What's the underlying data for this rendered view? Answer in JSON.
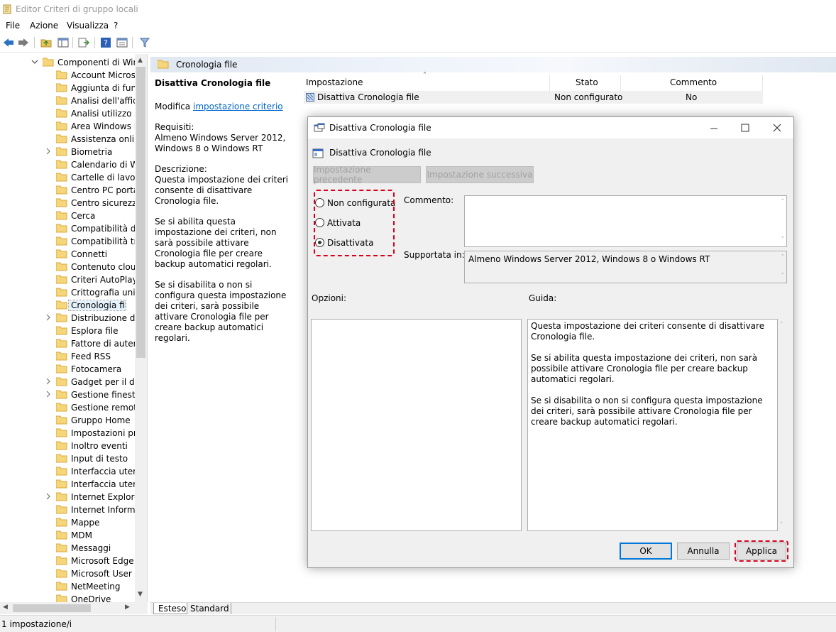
{
  "window": {
    "title": "Editor Criteri di gruppo locali"
  },
  "menu": [
    "File",
    "Azione",
    "Visualizza",
    "?"
  ],
  "tree": {
    "parent": "Componenti di Wind",
    "items": [
      "Account Microso",
      "Aggiunta di funz",
      "Analisi dell'affida",
      "Analisi utilizzo so",
      "Area Windows In",
      "Assistenza online",
      "Biometria",
      "Calendario di Wi",
      "Cartelle di lavoro",
      "Centro PC portat",
      "Centro sicurezza",
      "Cerca",
      "Compatibilità di",
      "Compatibilità tra",
      "Connetti",
      "Contenuto cloud",
      "Criteri AutoPlay",
      "Crittografia unità",
      "Cronologia file",
      "Distribuzione di p",
      "Esplora file",
      "Fattore di autenti",
      "Feed RSS",
      "Fotocamera",
      "Gadget per il des",
      "Gestione finestre",
      "Gestione remota",
      "Gruppo Home",
      "Impostazioni pre",
      "Inoltro eventi",
      "Input di testo",
      "Interfaccia utente",
      "Interfaccia utente",
      "Internet Explorer",
      "Internet Informat",
      "Mappe",
      "MDM",
      "Messaggi",
      "Microsoft Edge",
      "Microsoft User Ex",
      "NetMeeting",
      "OneDrive"
    ]
  },
  "right_header": "Cronologia file",
  "description": {
    "title": "Disattiva Cronologia file",
    "edit_prefix": "Modifica",
    "edit_link": "impostazione criterio",
    "req_label": "Requisiti:",
    "req_text": "Almeno Windows Server 2012, Windows 8 o Windows RT",
    "desc_label": "Descrizione:",
    "p1": "Questa impostazione dei criteri consente di disattivare Cronologia file.",
    "p2": "Se si abilita questa impostazione dei criteri, non sarà possibile attivare Cronologia file per creare backup automatici regolari.",
    "p3": "Se si disabilita o non si configura questa impostazione dei criteri, sarà possibile attivare Cronologia file per creare backup automatici regolari."
  },
  "list": {
    "columns": [
      "Impostazione",
      "Stato",
      "Commento"
    ],
    "rows": [
      {
        "name": "Disattiva Cronologia file",
        "state": "Non configurato",
        "comment": "No"
      }
    ]
  },
  "tabs": [
    "Esteso",
    "Standard"
  ],
  "status": "1 impostazione/i",
  "dialog": {
    "title": "Disattiva Cronologia file",
    "subtitle": "Disattiva Cronologia file",
    "prev_btn": "Impostazione precedente",
    "next_btn": "Impostazione successiva",
    "radios": [
      "Non configurata",
      "Attivata",
      "Disattivata"
    ],
    "selected": "Disattivata",
    "comment_label": "Commento:",
    "comment_value": "",
    "supported_label": "Supportata in:",
    "supported_value": "Almeno Windows Server 2012, Windows 8 o Windows RT",
    "options_label": "Opzioni:",
    "help_label": "Guida:",
    "help_p1": "Questa impostazione dei criteri consente di disattivare Cronologia file.",
    "help_p2": "Se si abilita questa impostazione dei criteri, non sarà possibile attivare Cronologia file per creare backup automatici regolari.",
    "help_p3": "Se si disabilita o non si configura questa impostazione dei criteri, sarà possibile attivare Cronologia file per creare backup automatici regolari.",
    "ok": "OK",
    "cancel": "Annulla",
    "apply": "Applica"
  },
  "colors": {
    "highlight": "#d7001b",
    "accent": "#0078d7",
    "link": "#0066cc"
  }
}
